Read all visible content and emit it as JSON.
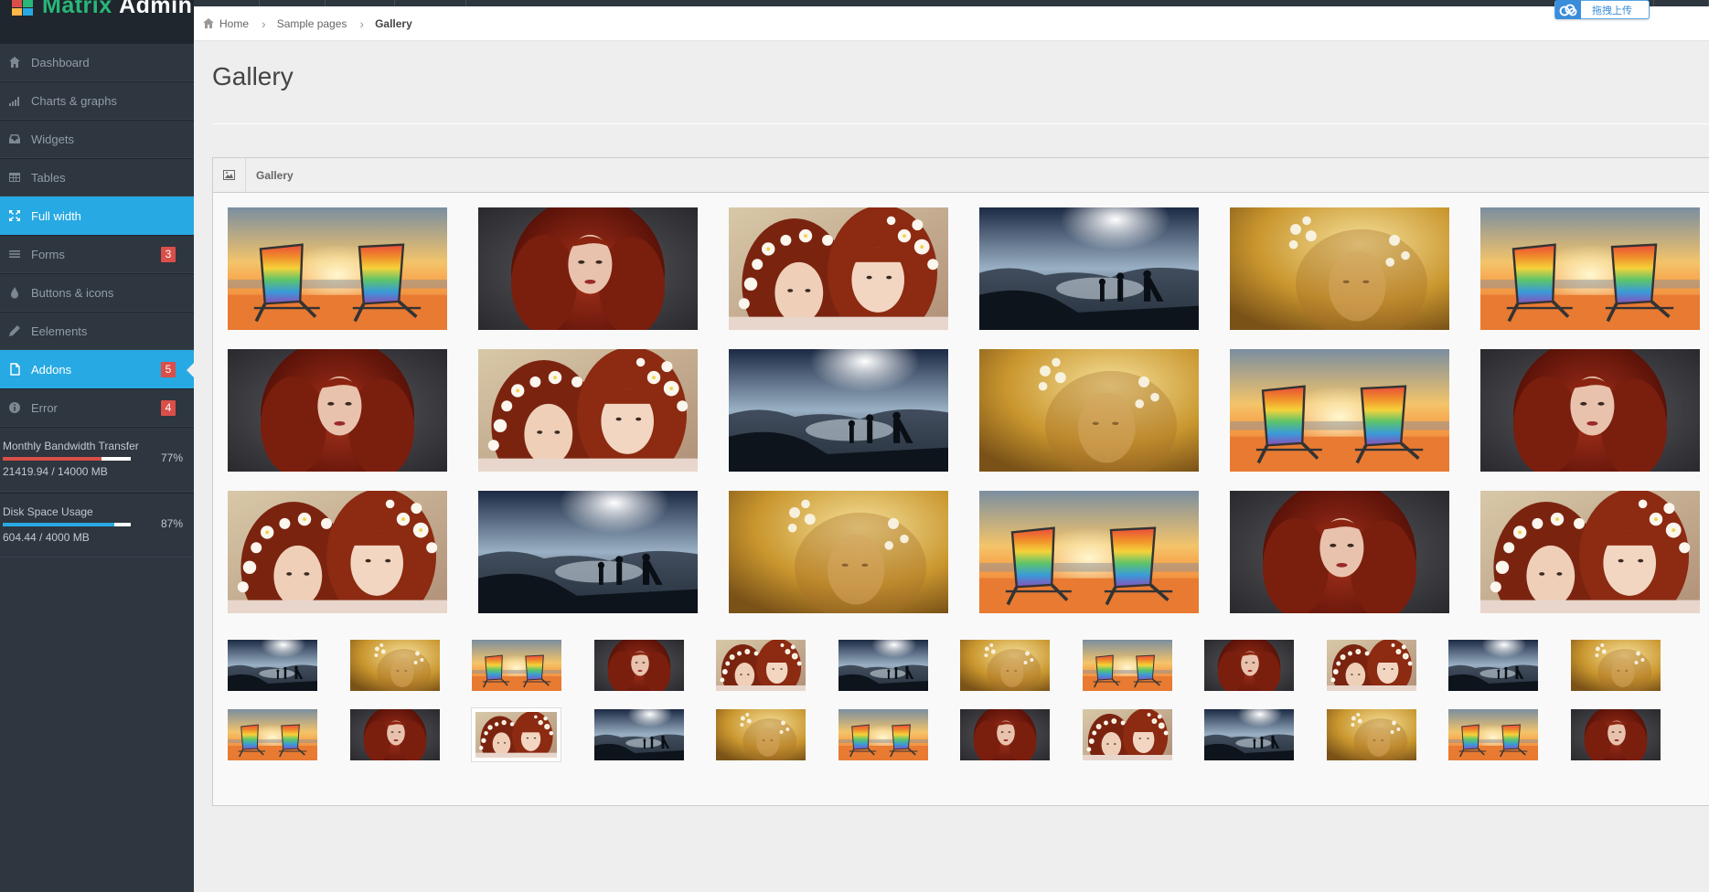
{
  "brand": {
    "name_part1": "Matrix",
    "name_part2": "Admin"
  },
  "colors": {
    "sidebar_bg": "#2e363f",
    "accent": "#27a9e3",
    "badge": "#da4f49",
    "brand_green": "#28b779"
  },
  "sidebar": {
    "items": [
      {
        "label": "Dashboard",
        "icon": "home-icon",
        "active": false
      },
      {
        "label": "Charts & graphs",
        "icon": "signal-icon",
        "active": false
      },
      {
        "label": "Widgets",
        "icon": "inbox-icon",
        "active": false
      },
      {
        "label": "Tables",
        "icon": "table-icon",
        "active": false
      },
      {
        "label": "Full width",
        "icon": "fullscreen-icon",
        "active": true
      },
      {
        "label": "Forms",
        "icon": "list-icon",
        "active": false,
        "badge": "3"
      },
      {
        "label": "Buttons & icons",
        "icon": "tint-icon",
        "active": false
      },
      {
        "label": "Eelements",
        "icon": "pencil-icon",
        "active": false
      },
      {
        "label": "Addons",
        "icon": "file-icon",
        "active": true,
        "badge": "5"
      },
      {
        "label": "Error",
        "icon": "info-sign-icon",
        "active": false,
        "badge": "4"
      }
    ],
    "stats": [
      {
        "label": "Monthly Bandwidth Transfer",
        "value": "21419.94 / 14000 MB",
        "percent": "77%",
        "fill": 0.77,
        "color": "#da4f49"
      },
      {
        "label": "Disk Space Usage",
        "value": "604.44 / 4000 MB",
        "percent": "87%",
        "fill": 0.87,
        "color": "#27a9e3"
      }
    ]
  },
  "breadcrumb": {
    "items": [
      {
        "label": "Home",
        "icon": "home-icon"
      },
      {
        "label": "Sample pages"
      },
      {
        "label": "Gallery",
        "current": true
      }
    ]
  },
  "upload": {
    "label": "拖拽上传",
    "icon": "cloud-icon"
  },
  "page": {
    "title": "Gallery"
  },
  "widget": {
    "title": "Gallery",
    "icon": "picture-icon"
  },
  "gallery": {
    "large_rows": [
      [
        "beach",
        "redhead",
        "flowers",
        "hikers",
        "golden",
        "beach"
      ],
      [
        "redhead",
        "flowers",
        "hikers",
        "golden",
        "beach",
        "redhead"
      ],
      [
        "flowers",
        "hikers",
        "golden",
        "beach",
        "redhead",
        "flowers"
      ]
    ],
    "small_rows": [
      [
        "hikers",
        "golden",
        "beach",
        "redhead",
        "flowers",
        "hikers",
        "golden",
        "beach",
        "redhead",
        "flowers",
        "hikers",
        "golden"
      ],
      [
        "beach",
        "redhead",
        "flowers",
        "hikers",
        "golden",
        "beach",
        "redhead",
        "flowers",
        "hikers",
        "golden",
        "beach",
        "redhead"
      ]
    ],
    "selected_small": {
      "row": 1,
      "col": 2
    }
  }
}
